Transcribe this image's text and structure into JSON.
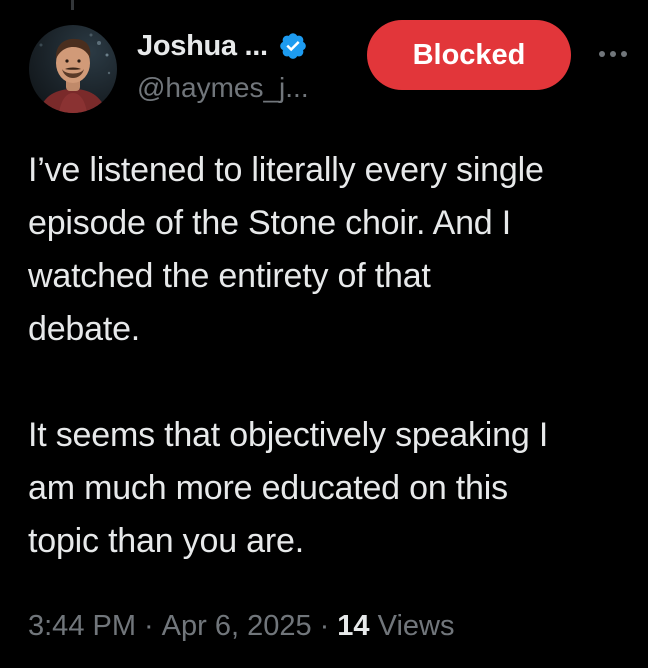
{
  "author": {
    "display_name": "Joshua ...",
    "handle": "@haymes_j...",
    "verified_icon": "verified-badge-icon",
    "avatar_icon": "profile-photo"
  },
  "header": {
    "blocked_label": "Blocked",
    "more_icon": "more-options-icon"
  },
  "tweet": {
    "paragraph_1": "I’ve listened to literally every single\nepisode of the Stone choir. And I\nwatched the entirety of that\ndebate.",
    "paragraph_2": "It seems that objectively speaking I\nam much more educated on this\ntopic than you are."
  },
  "meta": {
    "time": "3:44 PM",
    "separator": "·",
    "date": "Apr 6, 2025",
    "views_count": "14",
    "views_label": "Views"
  },
  "colors": {
    "background": "#000000",
    "text_primary": "#e7e9ea",
    "text_secondary": "#71767b",
    "blocked_red": "#e2363a",
    "verified_blue": "#1d9bf0"
  }
}
